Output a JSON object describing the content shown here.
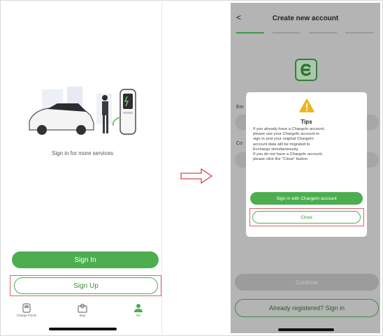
{
  "left_screen": {
    "message": "Sign in for more services",
    "signin_button": "Sign In",
    "signup_button": "Sign Up",
    "tabs": [
      {
        "label": "Charge Points",
        "icon": "charger-icon"
      },
      {
        "label": "Map",
        "icon": "map-icon"
      },
      {
        "label": "Me",
        "icon": "person-icon"
      }
    ],
    "accent_color": "#4cae4f",
    "highlight_color": "#d9646a"
  },
  "right_screen": {
    "back_glyph": "<",
    "title": "Create new account",
    "bg_label_email": "Em",
    "bg_label_code": "Co",
    "bg_continue": "Continue",
    "bg_already": "Already registered? Sign in",
    "dialog": {
      "title": "Tips",
      "lines": [
        "If you already have a ChargeIn account,",
        "please use your ChargeIn account to",
        "sign in and your original ChargeIn",
        "account data will be migrated to",
        "Evchargo simultaneously.",
        "If you do not have a ChargeIn account,",
        "please click the \"Close\" button."
      ],
      "primary_button": "Sign in with ChargeIn account",
      "close_button": "Close"
    }
  }
}
